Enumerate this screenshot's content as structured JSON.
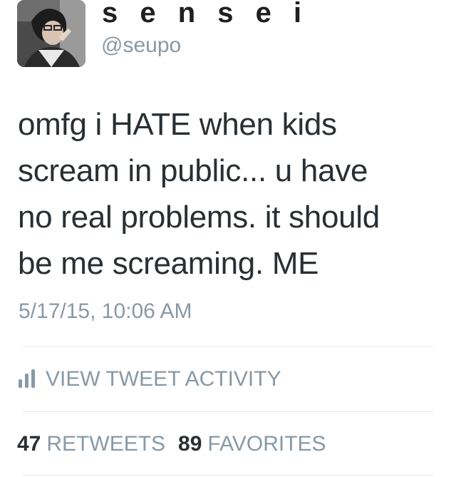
{
  "user": {
    "display_name": "s e n s e i",
    "handle": "@seupo",
    "avatar_icon": "user-avatar-photo"
  },
  "tweet": {
    "text_lines": [
      "omfg i HATE when kids",
      "scream in public... u have",
      "no real problems. it should",
      "be me screaming. ME"
    ],
    "timestamp": "5/17/15, 10:06 AM"
  },
  "activity": {
    "icon": "bar-chart-icon",
    "label": "VIEW TWEET ACTIVITY"
  },
  "stats": {
    "retweets_count": "47",
    "retweets_label": "RETWEETS",
    "favorites_count": "89",
    "favorites_label": "FAVORITES"
  },
  "colors": {
    "text": "#292f33",
    "muted": "#8899a6",
    "divider": "#e1e8ed"
  }
}
